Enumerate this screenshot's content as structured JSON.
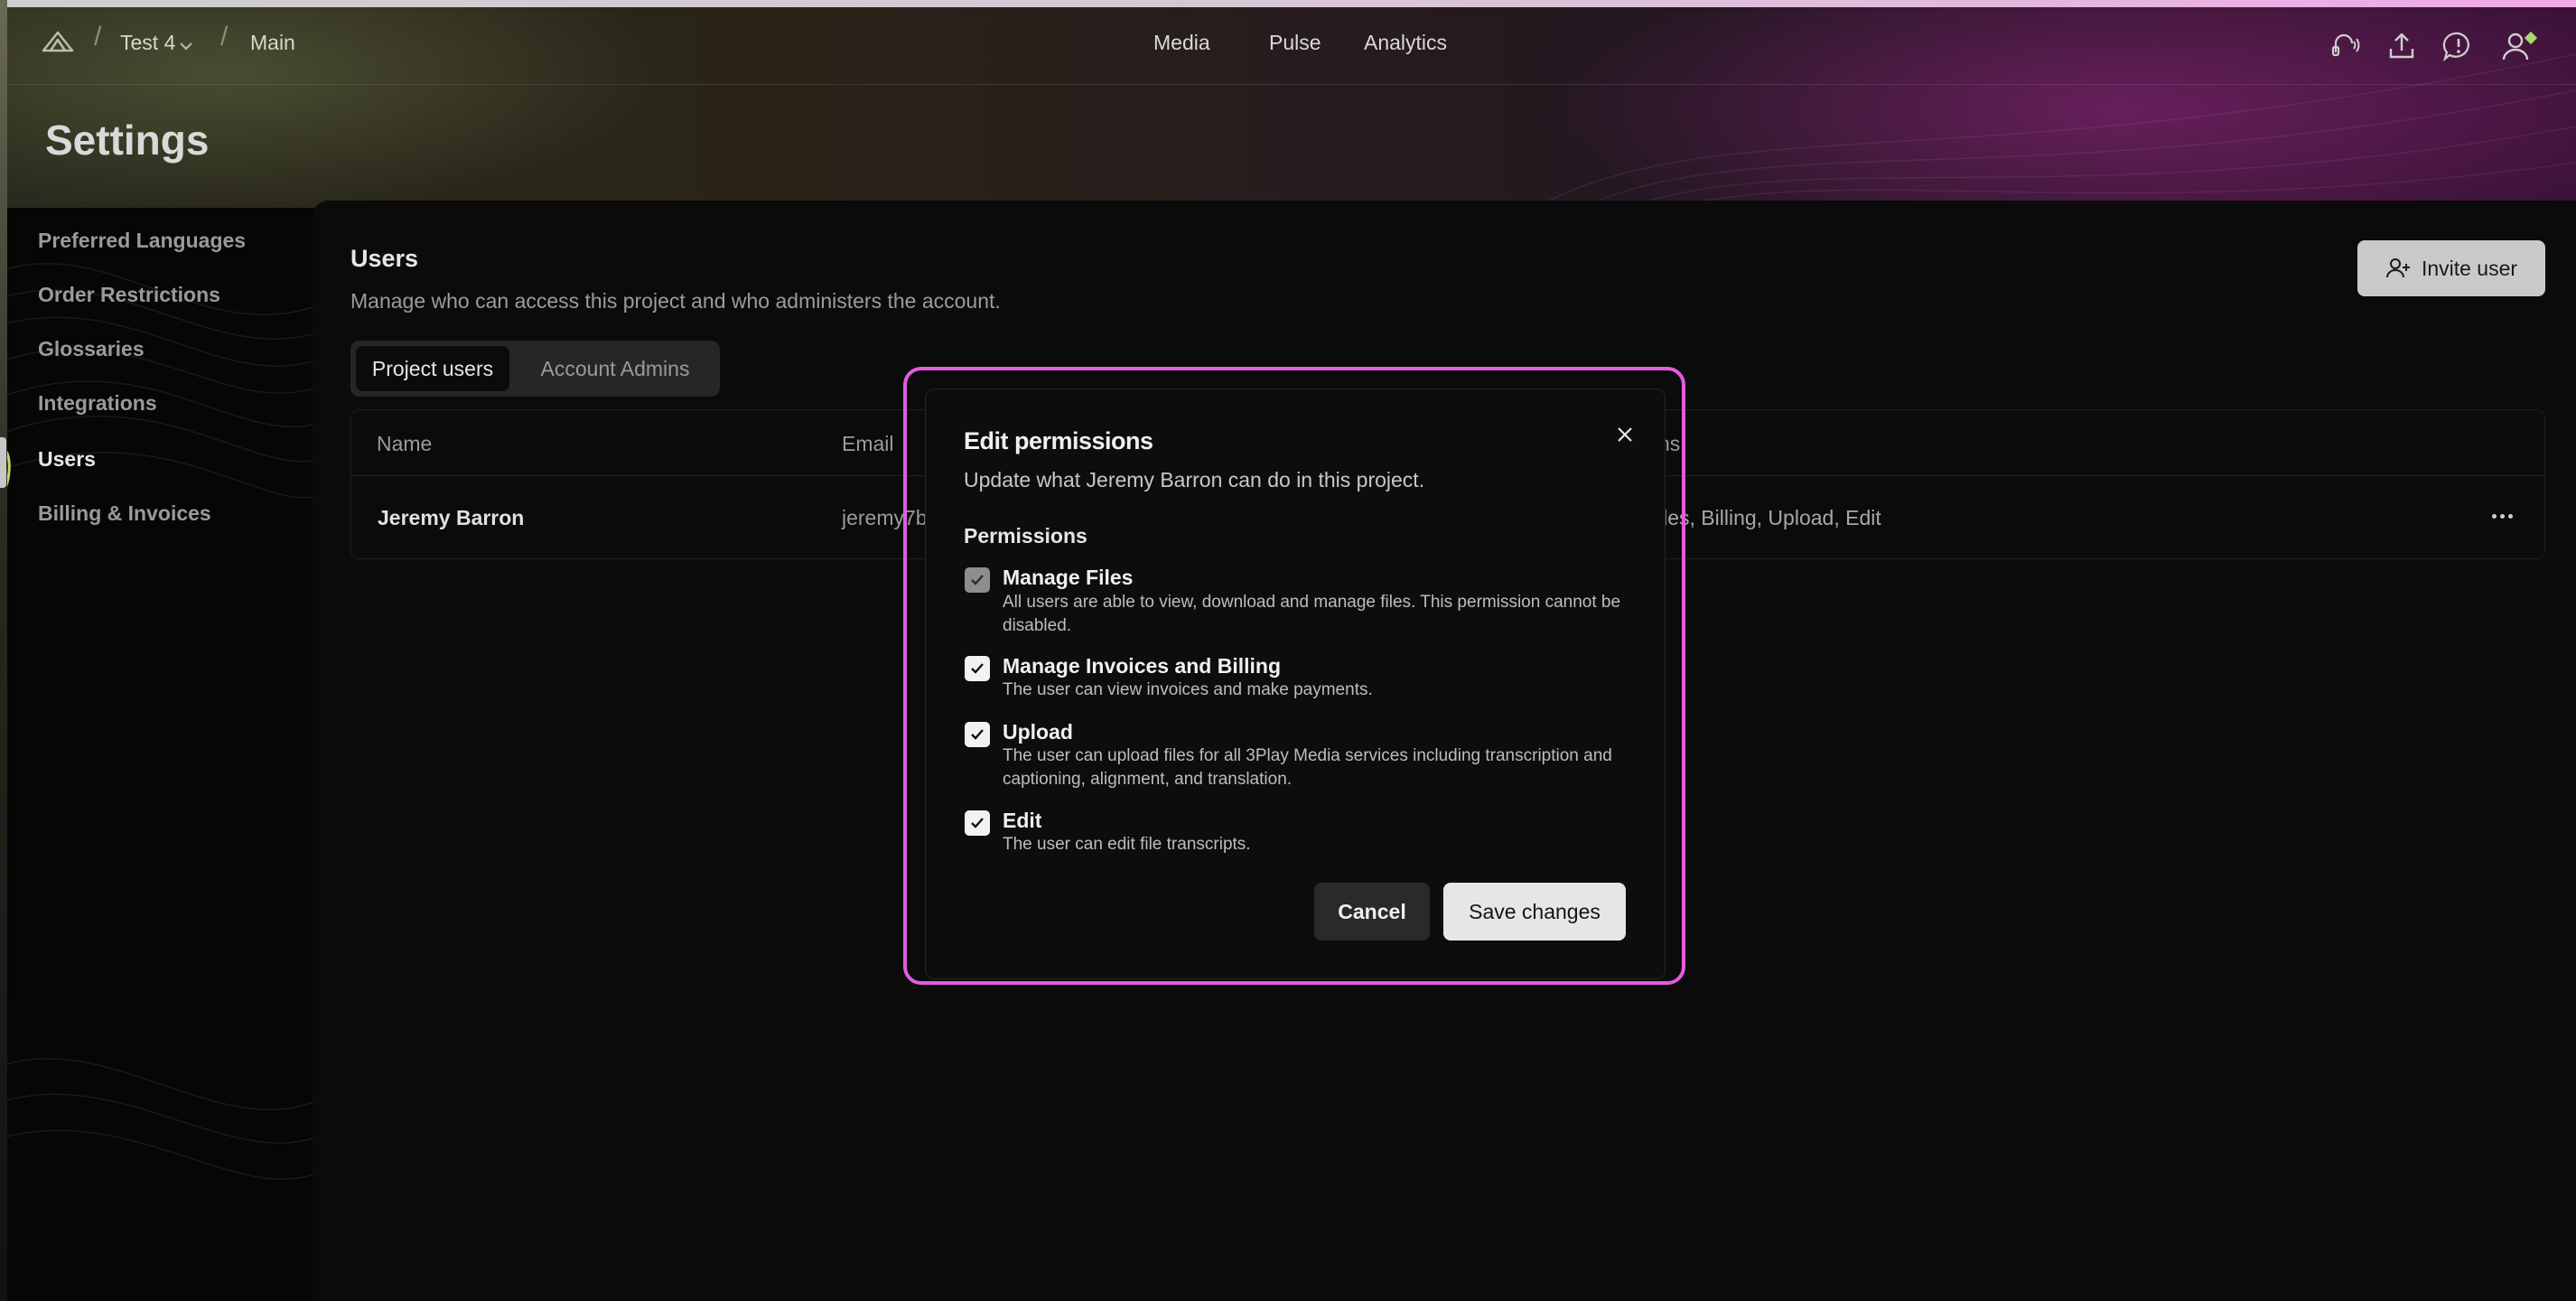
{
  "breadcrumb": {
    "project": "Test 4",
    "branch": "Main"
  },
  "nav": {
    "items": [
      "Media",
      "Pulse",
      "Analytics"
    ]
  },
  "nav_icons": [
    "headset-icon",
    "upload-icon",
    "chat-icon",
    "user-icon"
  ],
  "page": {
    "title": "Settings"
  },
  "sidebar": {
    "items": [
      {
        "label": "Preferred Languages"
      },
      {
        "label": "Order Restrictions"
      },
      {
        "label": "Glossaries"
      },
      {
        "label": "Integrations"
      },
      {
        "label": "Users",
        "active": true
      },
      {
        "label": "Billing & Invoices"
      }
    ]
  },
  "users": {
    "title": "Users",
    "subtitle": "Manage who can access this project and who administers the account.",
    "invite_label": "Invite user",
    "tabs": [
      {
        "label": "Project users",
        "active": true
      },
      {
        "label": "Account Admins",
        "active": false
      }
    ],
    "table": {
      "columns": {
        "name": "Name",
        "email": "Email",
        "permissions_fragment": "ns"
      },
      "rows": [
        {
          "name": "Jeremy Barron",
          "email_fragment": "jeremy7b",
          "permissions_fragment": "iles, Billing, Upload, Edit"
        }
      ]
    }
  },
  "modal": {
    "title": "Edit permissions",
    "subtitle": "Update what Jeremy Barron can do in this project.",
    "permissions_heading": "Permissions",
    "permissions": [
      {
        "title": "Manage Files",
        "desc": "All users are able to view, download and manage files. This permission cannot be disabled.",
        "checked": true,
        "disabled": true
      },
      {
        "title": "Manage Invoices and Billing",
        "desc": "The user can view invoices and make payments.",
        "checked": true,
        "disabled": false
      },
      {
        "title": "Upload",
        "desc": "The user can upload files for all 3Play Media services including transcription and captioning, alignment, and translation.",
        "checked": true,
        "disabled": false
      },
      {
        "title": "Edit",
        "desc": "The user can edit file transcripts.",
        "checked": true,
        "disabled": false
      }
    ],
    "cancel_label": "Cancel",
    "save_label": "Save changes"
  },
  "colors": {
    "highlight": "#e45be0",
    "status_dot": "#a6d86a",
    "accent_hero": "#3a1236"
  }
}
